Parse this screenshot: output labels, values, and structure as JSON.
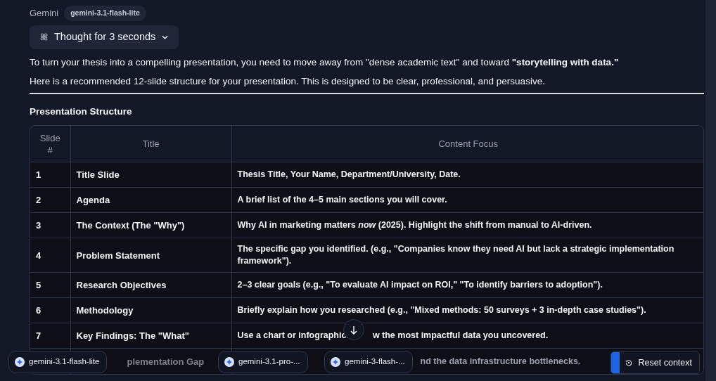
{
  "header": {
    "assistant": "Gemini",
    "model_badge": "gemini-3.1-flash-lite"
  },
  "thought": {
    "label": "Thought for 3 seconds",
    "expanded": false
  },
  "paragraphs": [
    "To turn your thesis into a compelling presentation, you need to move away from \"dense academic text\" and toward **\"storytelling with data.\"**",
    "Here is a recommended 12-slide structure for your presentation. This is designed to be clear, professional, and persuasive."
  ],
  "section_title": "Presentation Structure",
  "table": {
    "columns": [
      "Slide #",
      "Title",
      "Content Focus"
    ],
    "rows": [
      {
        "slide": "1",
        "title": "Title Slide",
        "content": "Thesis Title, Your Name, Department/University, Date."
      },
      {
        "slide": "2",
        "title": "Agenda",
        "content": "A brief list of the 4–5 main sections you will cover."
      },
      {
        "slide": "3",
        "title": "The Context (The \"Why\")",
        "content": "Why AI in marketing matters *now* (2025). Highlight the shift from manual to AI-driven."
      },
      {
        "slide": "4",
        "title": "Problem Statement",
        "content": "The specific gap you identified. (e.g., \"Companies know they need AI but lack a strategic implementation framework\")."
      },
      {
        "slide": "5",
        "title": "Research Objectives",
        "content": "2–3 clear goals (e.g., \"To evaluate AI impact on ROI,\" \"To identify barriers to adoption\")."
      },
      {
        "slide": "6",
        "title": "Methodology",
        "content": "Briefly explain how you researched (e.g., \"Mixed methods: 50 surveys + 3 in-depth case studies\")."
      },
      {
        "slide": "7",
        "title": "Key Findings: The \"What\"",
        "content": "Use a chart or infographic.",
        "content_after": "w the most impactful data you uncovered."
      },
      {
        "title": "plementation Gap",
        "content": "nd the data infrastructure bottlenecks."
      }
    ]
  },
  "model_chips": [
    {
      "label": "gemini-3.1-flash-lite",
      "faded": false
    },
    {
      "label": "gemini-3.1-pro-...",
      "faded": false
    },
    {
      "label": "gemini-3-flash-...",
      "faded": false
    }
  ],
  "reset_button": "Reset context"
}
